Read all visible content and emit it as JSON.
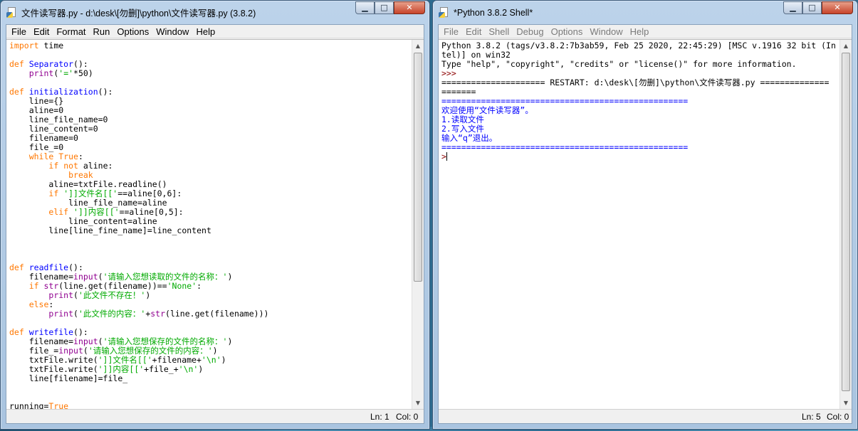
{
  "editor_window": {
    "title": "文件读写器.py - d:\\desk\\[勿删]\\python\\文件读写器.py (3.8.2)",
    "menu": [
      "File",
      "Edit",
      "Format",
      "Run",
      "Options",
      "Window",
      "Help"
    ],
    "code_lines": [
      "import time",
      "",
      "def Separator():",
      "    print('='*50)",
      "",
      "def initialization():",
      "    line={}",
      "    aline=0",
      "    line_file_name=0",
      "    line_content=0",
      "    filename=0",
      "    file_=0",
      "    while True:",
      "        if not aline:",
      "            break",
      "        aline=txtFile.readline()",
      "        if ']]文件名[['==aline[0,6]:",
      "            line_file_name=aline",
      "        elif ']]内容[['==aline[0,5]:",
      "            line_content=aline",
      "        line[line_fine_name]=line_content",
      "",
      "",
      "",
      "def readfile():",
      "    filename=input('请输入您想读取的文件的名称：')",
      "    if str(line.get(filename))=='None':",
      "        print('此文件不存在！')",
      "    else:",
      "        print('此文件的内容：'+str(line.get(filename)))",
      "",
      "def writefile():",
      "    filename=input('请输入您想保存的文件的名称：')",
      "    file_=input('请输入您想保存的文件的内容：')",
      "    txtFile.write(']]文件名[['+filename+'\\n')",
      "    txtFile.write(']]内容[['+file_+'\\n')",
      "    line[filename]=file_",
      "",
      "",
      "running=True"
    ],
    "status": {
      "ln": "Ln: 1",
      "col": "Col: 0"
    }
  },
  "shell_window": {
    "title": "*Python 3.8.2 Shell*",
    "menu": [
      "File",
      "Edit",
      "Shell",
      "Debug",
      "Options",
      "Window",
      "Help"
    ],
    "lines": [
      "Python 3.8.2 (tags/v3.8.2:7b3ab59, Feb 25 2020, 22:45:29) [MSC v.1916 32 bit (In",
      "tel)] on win32",
      "Type \"help\", \"copyright\", \"credits\" or \"license()\" for more information.",
      ">>>",
      "===================== RESTART: d:\\desk\\[勿删]\\python\\文件读写器.py ==============",
      "=======",
      "==================================================",
      "欢迎使用“文件读写器”。",
      "1.读取文件",
      "2.写入文件",
      "输入“q”退出。",
      "==================================================",
      ">"
    ],
    "status": {
      "ln": "Ln: 5",
      "col": "Col: 0"
    }
  },
  "colors": {
    "keyword": "#ff7700",
    "builtin": "#900090",
    "string": "#00aa00",
    "definition": "#0000ff",
    "stdout": "#0000ff",
    "prompt": "#8b0000"
  },
  "icons": [
    "python-file-icon",
    "minimize-icon",
    "maximize-icon",
    "close-icon",
    "scroll-up-arrow-icon",
    "scroll-down-arrow-icon"
  ]
}
